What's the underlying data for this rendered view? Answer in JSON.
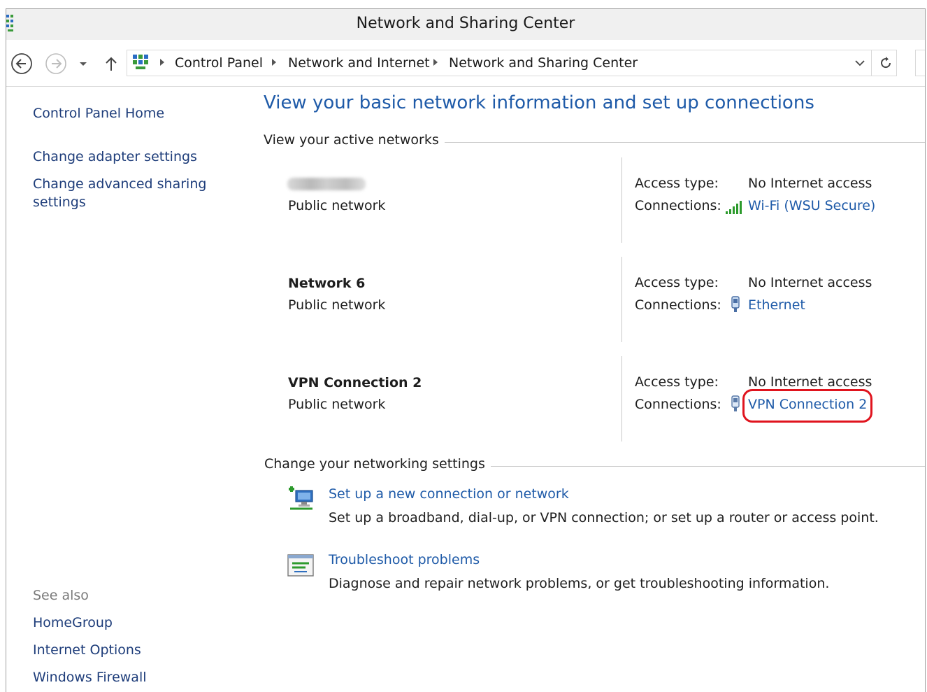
{
  "window": {
    "title": "Network and Sharing Center"
  },
  "navbar": {
    "breadcrumb": [
      "Control Panel",
      "Network and Internet",
      "Network and Sharing Center"
    ]
  },
  "sidebar": {
    "home": "Control Panel Home",
    "links": [
      "Change adapter settings",
      "Change advanced sharing",
      "settings"
    ],
    "see_also_label": "See also",
    "see_also": [
      "HomeGroup",
      "Internet Options",
      "Windows Firewall"
    ]
  },
  "main": {
    "heading": "View your basic network information and set up connections",
    "active_networks_title": "View your active networks",
    "access_label": "Access type:",
    "connections_label": "Connections:",
    "networks": [
      {
        "name": "",
        "type": "Public network",
        "access": "No Internet access",
        "connection": "Wi-Fi (WSU Secure)",
        "connection_icon": "wifi-signal-icon"
      },
      {
        "name": "Network  6",
        "type": "Public network",
        "access": "No Internet access",
        "connection": "Ethernet",
        "connection_icon": "ethernet-icon"
      },
      {
        "name": "VPN Connection 2",
        "type": "Public network",
        "access": "No Internet access",
        "connection": "VPN Connection 2",
        "connection_icon": "vpn-adapter-icon"
      }
    ],
    "change_settings_title": "Change your networking settings",
    "tasks": [
      {
        "link": "Set up a new connection or network",
        "desc": "Set up a broadband, dial-up, or VPN connection; or set up a router or access point.",
        "icon": "new-connection-icon"
      },
      {
        "link": "Troubleshoot problems",
        "desc": "Diagnose and repair network problems, or get troubleshooting information.",
        "icon": "troubleshoot-icon"
      }
    ]
  },
  "colors": {
    "link": "#1e5aa8",
    "nav_link": "#1e3d7a",
    "highlight": "#e0141e"
  }
}
